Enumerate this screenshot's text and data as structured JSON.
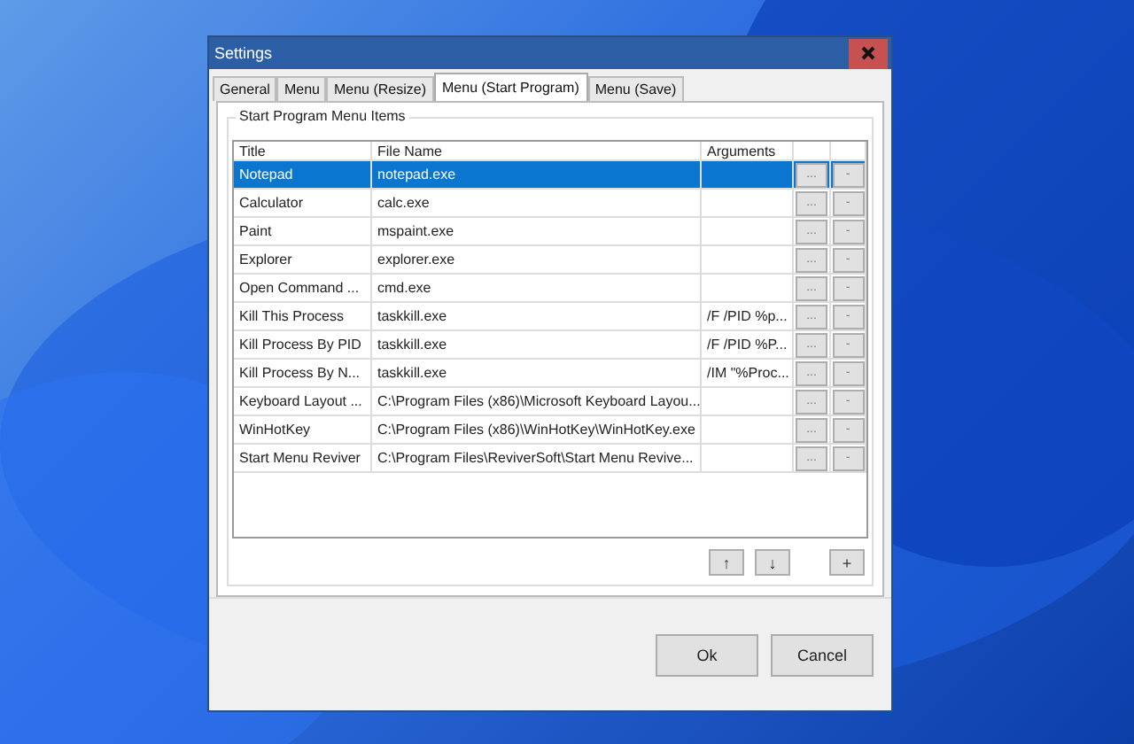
{
  "window": {
    "title": "Settings"
  },
  "tabs": [
    {
      "label": "General",
      "selected": false
    },
    {
      "label": "Menu",
      "selected": false
    },
    {
      "label": "Menu (Resize)",
      "selected": false
    },
    {
      "label": "Menu (Start Program)",
      "selected": true
    },
    {
      "label": "Menu (Save)",
      "selected": false
    }
  ],
  "group": {
    "title": "Start Program Menu Items"
  },
  "table": {
    "columns": [
      "Title",
      "File Name",
      "Arguments"
    ],
    "rows": [
      {
        "title": "Notepad",
        "file": "notepad.exe",
        "arguments": "",
        "browse": "...",
        "remove": "-",
        "selected": true
      },
      {
        "title": "Calculator",
        "file": "calc.exe",
        "arguments": "",
        "browse": "...",
        "remove": "-",
        "selected": false
      },
      {
        "title": "Paint",
        "file": "mspaint.exe",
        "arguments": "",
        "browse": "...",
        "remove": "-",
        "selected": false
      },
      {
        "title": "Explorer",
        "file": "explorer.exe",
        "arguments": "",
        "browse": "...",
        "remove": "-",
        "selected": false
      },
      {
        "title": "Open Command ...",
        "file": "cmd.exe",
        "arguments": "",
        "browse": "...",
        "remove": "-",
        "selected": false
      },
      {
        "title": "Kill This Process",
        "file": "taskkill.exe",
        "arguments": "/F /PID %p...",
        "browse": "...",
        "remove": "-",
        "selected": false
      },
      {
        "title": "Kill Process By PID",
        "file": "taskkill.exe",
        "arguments": "/F /PID %P...",
        "browse": "...",
        "remove": "-",
        "selected": false
      },
      {
        "title": "Kill Process By N...",
        "file": "taskkill.exe",
        "arguments": "/IM \"%Proc...",
        "browse": "...",
        "remove": "-",
        "selected": false
      },
      {
        "title": "Keyboard Layout ...",
        "file": "C:\\Program Files (x86)\\Microsoft Keyboard Layou...",
        "arguments": "",
        "browse": "...",
        "remove": "-",
        "selected": false
      },
      {
        "title": "WinHotKey",
        "file": "C:\\Program Files (x86)\\WinHotKey\\WinHotKey.exe",
        "arguments": "",
        "browse": "...",
        "remove": "-",
        "selected": false
      },
      {
        "title": "Start Menu Reviver",
        "file": "C:\\Program Files\\ReviverSoft\\Start Menu Revive...",
        "arguments": "",
        "browse": "...",
        "remove": "-",
        "selected": false
      }
    ]
  },
  "list_buttons": {
    "up": "↑",
    "down": "↓",
    "add": "+"
  },
  "buttons": [
    "Ok",
    "Cancel"
  ]
}
